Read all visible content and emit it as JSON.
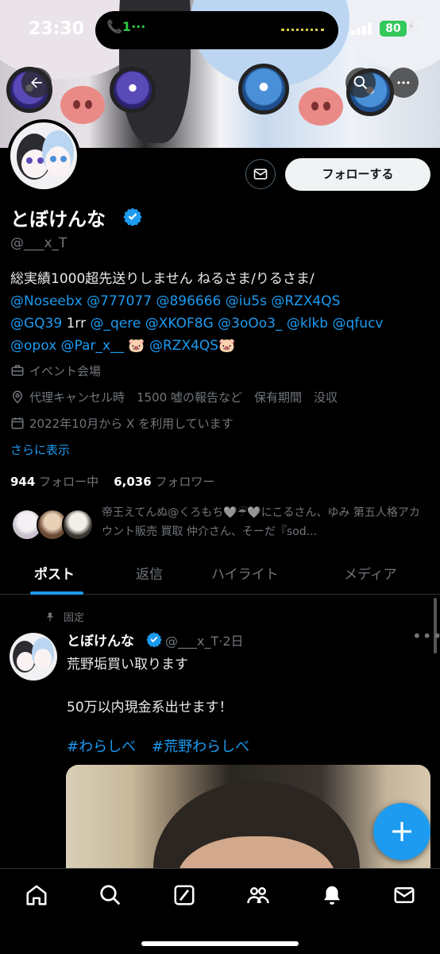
{
  "status_bar": {
    "time": "23:30",
    "call_indicator": "1",
    "battery": "80"
  },
  "header": {
    "back_icon": "arrow-left-icon",
    "search_icon": "search-icon",
    "more_icon": "more-horizontal-icon"
  },
  "profile": {
    "display_name": "とぼけんな",
    "handle": "@___x_T",
    "follow_label": "フォローする",
    "bio_line1": "総実績1000超先送りしません ねるさま/りるさま/",
    "bio_links_row2": [
      "@Noseebx",
      "@777077",
      "@896666",
      "@iu5s",
      "@RZX4QS"
    ],
    "bio_row3_a": "@GQ39",
    "bio_row3_text": "1rr",
    "bio_links_row3": [
      "@_qere",
      "@XKOF8G",
      "@3oOo3_",
      "@klkb",
      "@qfucv"
    ],
    "bio_row4_a": "@opox",
    "bio_row4_b": "@Par_x__",
    "bio_row4_emoji1": "🐷",
    "bio_row4_c": "@RZX4QS",
    "bio_row4_emoji2": "🐷",
    "category": "イベント会場",
    "location": "代理キャンセル時　1500 嘘の報告など　保有期間　没収",
    "joined": "2022年10月から X を利用しています",
    "show_more": "さらに表示",
    "following_count": "944",
    "following_label": "フォロー中",
    "followers_count": "6,036",
    "followers_label": "フォロワー",
    "followed_by_text": "帝王えてんぬ@くろもち🩶☔🩶にこるさん、ゆみ 第五人格アカウント販売 買取 仲介さん、そーだ『sod..."
  },
  "tabs": [
    {
      "label": "ポスト",
      "active": true
    },
    {
      "label": "返信",
      "active": false
    },
    {
      "label": "ハイライト",
      "active": false
    },
    {
      "label": "メディア",
      "active": false
    }
  ],
  "post": {
    "pinned_label": "固定",
    "author_name": "とぼけんな",
    "author_meta": "@___x_T·2日",
    "line1": "荒野垢買い取ります",
    "line2": "50万以内現金系出せます！",
    "hashtag1": "#わらしべ",
    "hashtag2": "#荒野わらしべ"
  },
  "bottom_nav": {
    "home": "home-icon",
    "explore": "search-icon",
    "grok": "grok-icon",
    "communities": "communities-icon",
    "notifications": "bell-icon",
    "messages": "mail-icon"
  },
  "colors": {
    "accent": "#1d9bf0",
    "background": "#000000",
    "muted": "#71767b"
  }
}
